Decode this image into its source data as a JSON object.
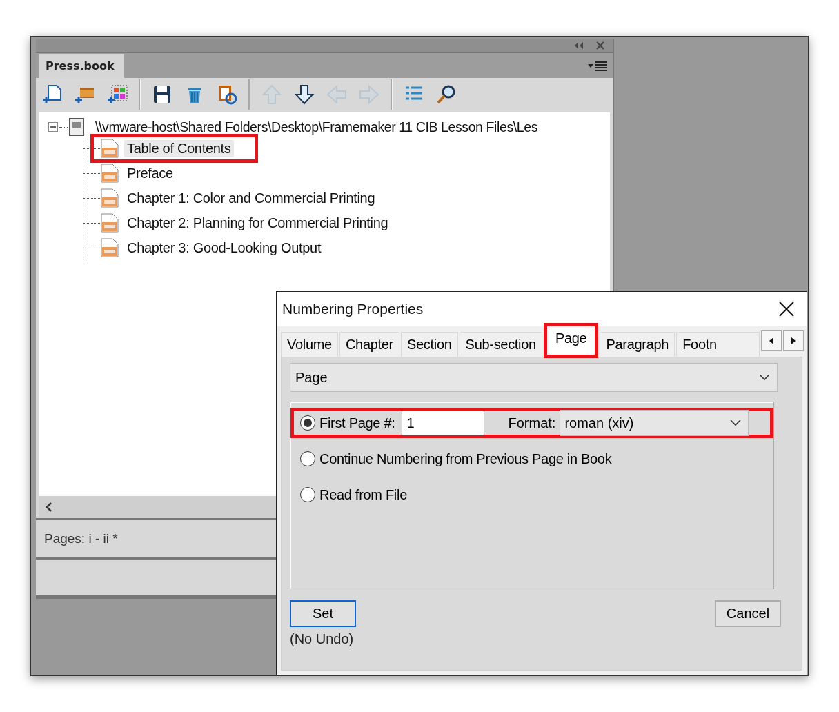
{
  "book_panel": {
    "tab": "Press.book",
    "toolbar": [
      [
        {
          "kind": "add-file",
          "disabled": false
        },
        {
          "kind": "add-folder",
          "disabled": false
        },
        {
          "kind": "add-grid",
          "disabled": false
        }
      ],
      [
        {
          "kind": "save",
          "disabled": false
        },
        {
          "kind": "trash",
          "disabled": false
        },
        {
          "kind": "refresh",
          "disabled": false
        }
      ],
      [
        {
          "kind": "up",
          "disabled": true
        },
        {
          "kind": "down",
          "disabled": false
        },
        {
          "kind": "left",
          "disabled": true
        },
        {
          "kind": "right",
          "disabled": true
        }
      ],
      [
        {
          "kind": "list",
          "disabled": false
        },
        {
          "kind": "search",
          "disabled": false
        }
      ]
    ],
    "tree": {
      "label": "\\\\vmware-host\\Shared Folders\\Desktop\\Framemaker 11 CIB Lesson Files\\Les",
      "expanded": true,
      "children": [
        {
          "label": "Table of Contents",
          "selected": true,
          "highlighted": true
        },
        {
          "label": "Preface",
          "selected": false,
          "highlighted": false
        },
        {
          "label": "Chapter 1: Color and Commercial Printing",
          "selected": false,
          "highlighted": false
        },
        {
          "label": "Chapter 2: Planning for Commercial Printing",
          "selected": false,
          "highlighted": false
        },
        {
          "label": "Chapter 3: Good-Looking Output",
          "selected": false,
          "highlighted": false
        }
      ]
    },
    "status": "Pages: i - ii *"
  },
  "dialog": {
    "title": "Numbering Properties",
    "tabs": [
      {
        "label": "Volume",
        "selected": false,
        "highlighted": false
      },
      {
        "label": "Chapter",
        "selected": false,
        "highlighted": false
      },
      {
        "label": "Section",
        "selected": false,
        "highlighted": false
      },
      {
        "label": "Sub-section",
        "selected": false,
        "highlighted": false
      },
      {
        "label": "Page",
        "selected": true,
        "highlighted": true
      },
      {
        "label": "Paragraph",
        "selected": false,
        "highlighted": false
      },
      {
        "label": "Footn",
        "selected": false,
        "highlighted": false
      }
    ],
    "component": "Page",
    "options": [
      {
        "kind": "first-page",
        "label": "First Page #:",
        "selected": true,
        "highlighted": true,
        "value": "1",
        "format_label": "Format:",
        "format": "roman  (xiv)"
      },
      {
        "kind": "plain",
        "label": "Continue Numbering from Previous Page in Book",
        "selected": false,
        "highlighted": false
      },
      {
        "kind": "plain",
        "label": "Read from File",
        "selected": false,
        "highlighted": false
      }
    ],
    "buttons": [
      {
        "label": "Set",
        "default": true
      },
      {
        "label": "Cancel",
        "default": false
      }
    ],
    "note": "(No Undo)"
  }
}
